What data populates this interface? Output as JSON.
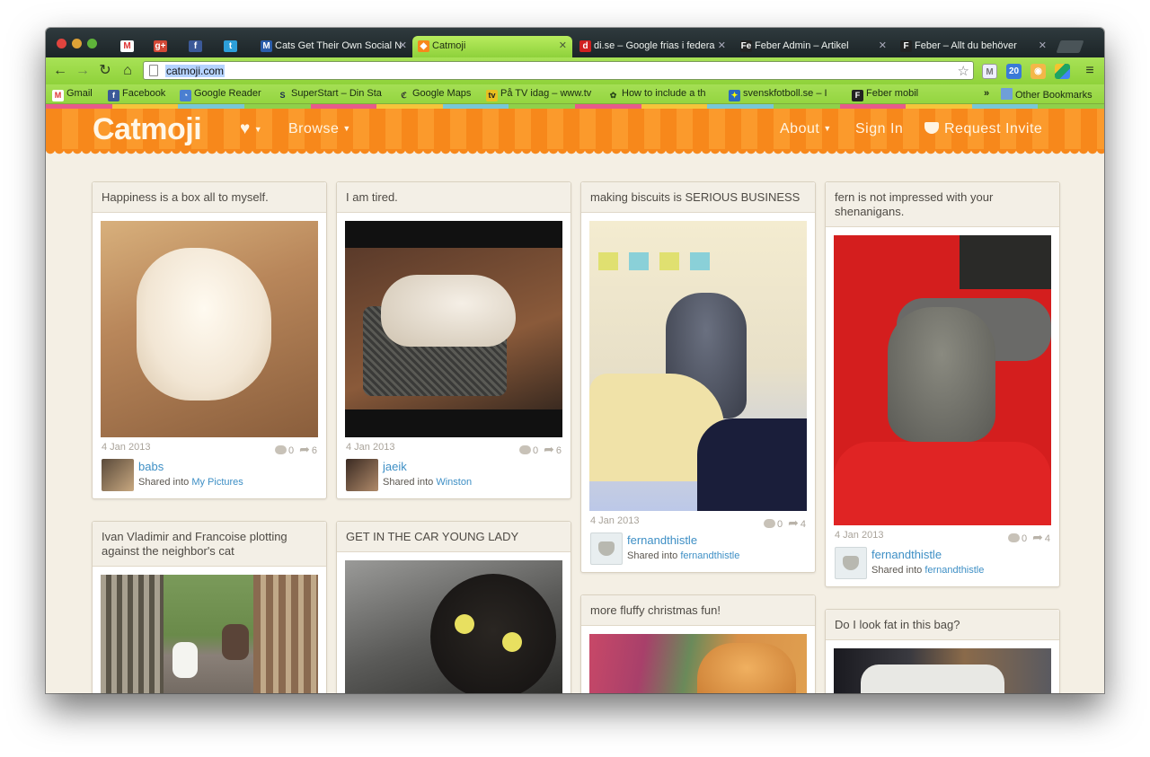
{
  "browser": {
    "tabs": [
      {
        "label": "Cats Get Their Own Social N",
        "favicon": "M",
        "color": "#2a5caa"
      },
      {
        "label": "Catmoji",
        "favicon": "cat-icon",
        "color": "#f7881b"
      },
      {
        "label": "di.se – Google frias i federa",
        "favicon": "d",
        "color": "#d02020"
      },
      {
        "label": "Feber Admin – Artikel",
        "favicon": "Fe",
        "color": "#222222"
      },
      {
        "label": "Feber – Allt du behöver",
        "favicon": "F",
        "color": "#222222"
      }
    ],
    "pinned_tabs": [
      "gmail-icon",
      "google-plus-icon",
      "facebook-icon",
      "twitter-icon"
    ],
    "url": "catmoji.com",
    "extensions": [
      "gmail-extension-icon",
      "calendar-icon",
      "cat-extension-icon",
      "drive-icon"
    ],
    "calendar_badge": "20",
    "bookmarks": [
      {
        "label": "Gmail",
        "icon": "gmail-icon"
      },
      {
        "label": "Facebook",
        "icon": "facebook-icon"
      },
      {
        "label": "Google Reader",
        "icon": "rss-icon"
      },
      {
        "label": "SuperStart – Din Sta",
        "icon": "superstart-icon"
      },
      {
        "label": "Google Maps",
        "icon": "maps-icon"
      },
      {
        "label": "På TV idag – www.tv",
        "icon": "tv-icon"
      },
      {
        "label": "How to include a th",
        "icon": "android-icon"
      },
      {
        "label": "svenskfotboll.se – I",
        "icon": "football-icon"
      },
      {
        "label": "Feber mobil",
        "icon": "feber-icon"
      }
    ],
    "bookmarks_overflow": "»",
    "other_bookmarks": "Other Bookmarks"
  },
  "site": {
    "logo": "Catmoji",
    "nav": {
      "favorites_icon": "heart-icon",
      "browse": "Browse",
      "about": "About",
      "sign_in": "Sign In",
      "request_invite": "Request Invite"
    },
    "colors": {
      "header": "#f7881b",
      "link": "#3e8fc5",
      "background": "#f4efe4"
    }
  },
  "posts": [
    {
      "title": "Happiness is a box all to myself.",
      "date": "4 Jan 2013",
      "comments": "0",
      "shares": "6",
      "user": "babs",
      "shared_prefix": "Shared into",
      "album": "My Pictures"
    },
    {
      "title": "I am tired.",
      "date": "4 Jan 2013",
      "comments": "0",
      "shares": "6",
      "user": "jaeik",
      "shared_prefix": "Shared into",
      "album": "Winston"
    },
    {
      "title": "making biscuits is SERIOUS BUSINESS",
      "date": "4 Jan 2013",
      "comments": "0",
      "shares": "4",
      "user": "fernandthistle",
      "shared_prefix": "Shared into",
      "album": "fernandthistle"
    },
    {
      "title": "fern is not impressed with your shenanigans.",
      "date": "4 Jan 2013",
      "comments": "0",
      "shares": "4",
      "user": "fernandthistle",
      "shared_prefix": "Shared into",
      "album": "fernandthistle"
    },
    {
      "title": "Ivan Vladimir and Francoise plotting against the neighbor's cat"
    },
    {
      "title": "GET IN THE CAR YOUNG LADY"
    },
    {
      "title": "more fluffy christmas fun!"
    },
    {
      "title": "Do I look fat in this bag?"
    }
  ]
}
